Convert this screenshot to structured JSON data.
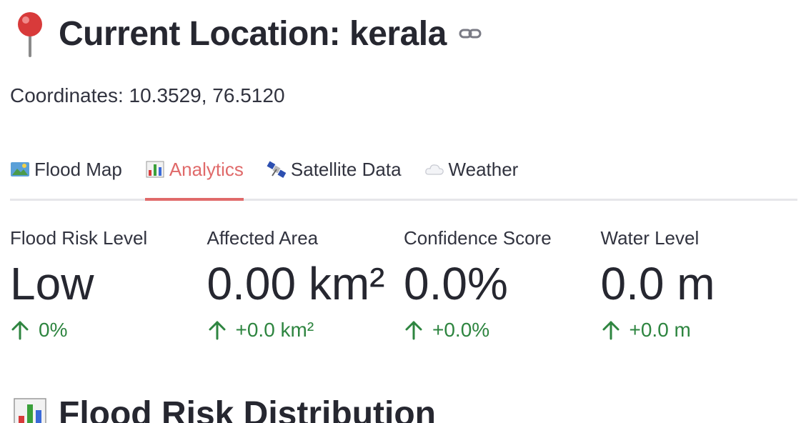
{
  "header": {
    "title": "Current Location: kerala",
    "icon": "map-pin-icon",
    "anchor_icon": "link-icon"
  },
  "coordinates_text": "Coordinates: 10.3529, 76.5120",
  "tabs": [
    {
      "label": "Flood Map",
      "icon": "map-icon",
      "active": false
    },
    {
      "label": "Analytics",
      "icon": "bar-chart-icon",
      "active": true
    },
    {
      "label": "Satellite Data",
      "icon": "satellite-icon",
      "active": false
    },
    {
      "label": "Weather",
      "icon": "cloud-icon",
      "active": false
    }
  ],
  "metrics": [
    {
      "label": "Flood Risk Level",
      "value": "Low",
      "delta": "0%"
    },
    {
      "label": "Affected Area",
      "value": "0.00 km²",
      "delta": "+0.0 km²"
    },
    {
      "label": "Confidence Score",
      "value": "0.0%",
      "delta": "+0.0%"
    },
    {
      "label": "Water Level",
      "value": "0.0 m",
      "delta": "+0.0 m"
    }
  ],
  "section": {
    "title": "Flood Risk Distribution",
    "icon": "bar-chart-icon"
  },
  "colors": {
    "accent": "#e06a6a",
    "delta_positive": "#2e8540",
    "text": "#31333f",
    "divider": "#e6e6ea"
  }
}
